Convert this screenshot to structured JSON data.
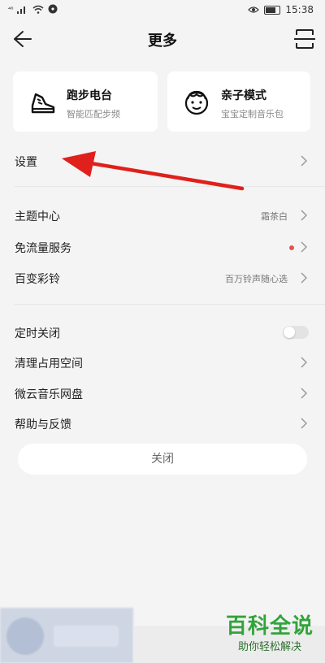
{
  "status_bar": {
    "signal": "⁴⁶",
    "time": "15:38"
  },
  "header": {
    "title": "更多"
  },
  "cards": [
    {
      "title": "跑步电台",
      "subtitle": "智能匹配步频",
      "icon": "running-shoe-icon"
    },
    {
      "title": "亲子模式",
      "subtitle": "宝宝定制音乐包",
      "icon": "child-face-icon"
    }
  ],
  "settings": {
    "label": "设置"
  },
  "group1": [
    {
      "label": "主题中心",
      "value": "霜茶白"
    },
    {
      "label": "免流量服务",
      "value": ""
    },
    {
      "label": "百变彩铃",
      "value": "百万铃声随心选"
    }
  ],
  "group2": [
    {
      "label": "定时关闭",
      "toggle": false
    },
    {
      "label": "清理占用空间"
    },
    {
      "label": "微云音乐网盘"
    },
    {
      "label": "帮助与反馈"
    }
  ],
  "close_button": {
    "label": "关闭"
  },
  "watermark": {
    "main": "百科全说",
    "sub": "助你轻松解决"
  },
  "colors": {
    "accent_red": "#e8524a",
    "annotation_arrow": "#e0201c",
    "watermark_green": "#31a43a"
  }
}
